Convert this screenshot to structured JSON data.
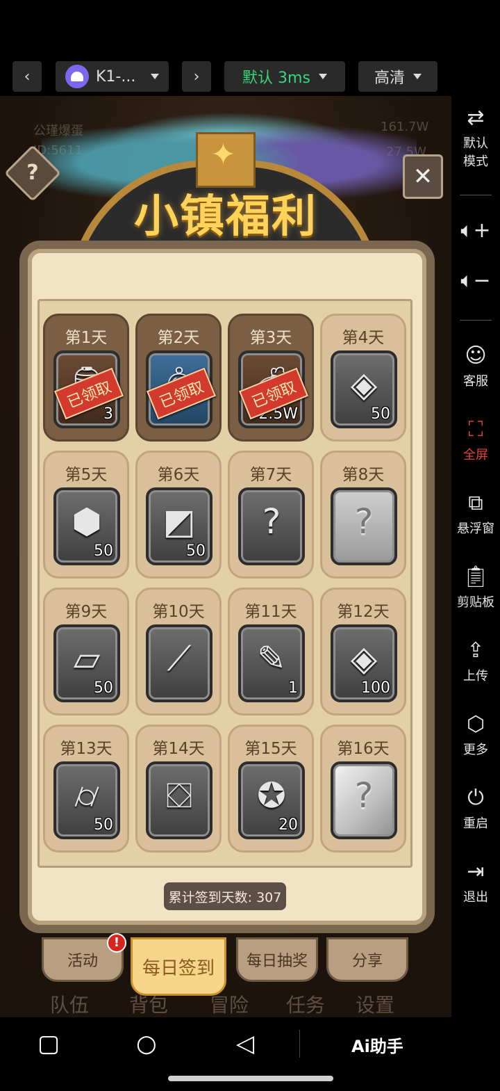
{
  "toolbar": {
    "device_label": "K1-...",
    "latency_label": "默认 3ms",
    "quality_label": "高清",
    "back_icon": "chevron-left-icon",
    "forward_icon": "chevron-right-icon"
  },
  "game": {
    "title": "小镇福利",
    "background_names": [
      "公瑾爆蛋",
      "ID:5611",
      "161.7W",
      "27.5W"
    ],
    "cards": [
      {
        "day": "第1天",
        "claimed": true,
        "stamp": "已领取",
        "qty": "3",
        "item_icon": "lantern-icon"
      },
      {
        "day": "第2天",
        "claimed": true,
        "stamp": "已领取",
        "qty": "",
        "item_icon": "bell-icon"
      },
      {
        "day": "第3天",
        "claimed": true,
        "stamp": "已领取",
        "qty": "2.5W",
        "item_icon": "coin-bag-icon"
      },
      {
        "day": "第4天",
        "claimed": false,
        "stamp": "",
        "qty": "50",
        "item_icon": "rune-stone-icon"
      },
      {
        "day": "第5天",
        "claimed": false,
        "stamp": "",
        "qty": "50",
        "item_icon": "ore-icon"
      },
      {
        "day": "第6天",
        "claimed": false,
        "stamp": "",
        "qty": "50",
        "item_icon": "fragment-icon"
      },
      {
        "day": "第7天",
        "claimed": false,
        "stamp": "",
        "qty": "",
        "item_icon": "question-icon"
      },
      {
        "day": "第8天",
        "claimed": false,
        "stamp": "",
        "qty": "",
        "item_icon": "question-icon"
      },
      {
        "day": "第9天",
        "claimed": false,
        "stamp": "",
        "qty": "50",
        "item_icon": "ingot-icon"
      },
      {
        "day": "第10天",
        "claimed": false,
        "stamp": "",
        "qty": "",
        "item_icon": "feather-icon"
      },
      {
        "day": "第11天",
        "claimed": false,
        "stamp": "",
        "qty": "1",
        "item_icon": "quill-icon"
      },
      {
        "day": "第12天",
        "claimed": false,
        "stamp": "",
        "qty": "100",
        "item_icon": "rune-stone-icon"
      },
      {
        "day": "第13天",
        "claimed": false,
        "stamp": "",
        "qty": "50",
        "item_icon": "log-icon"
      },
      {
        "day": "第14天",
        "claimed": false,
        "stamp": "",
        "qty": "",
        "item_icon": "backpack-icon"
      },
      {
        "day": "第15天",
        "claimed": false,
        "stamp": "",
        "qty": "20",
        "item_icon": "emblem-icon"
      },
      {
        "day": "第16天",
        "claimed": false,
        "stamp": "",
        "qty": "",
        "item_icon": "question-icon"
      }
    ],
    "total_label": "累计签到天数: 307",
    "tabs": [
      {
        "label": "活动",
        "badge": "!"
      },
      {
        "label": "每日签到",
        "active": true
      },
      {
        "label": "每日抽奖"
      },
      {
        "label": "分享"
      }
    ],
    "bottom_tabs": [
      "队伍",
      "背包",
      "冒险",
      "任务",
      "设置"
    ]
  },
  "sidebar": [
    {
      "label": "默认\n模式",
      "icon": "switch-mode-icon"
    },
    {
      "label": "",
      "icon": "volume-up-icon"
    },
    {
      "label": "",
      "icon": "volume-down-icon"
    },
    {
      "label": "客服",
      "icon": "customer-service-icon"
    },
    {
      "label": "全屏",
      "icon": "fullscreen-icon"
    },
    {
      "label": "悬浮窗",
      "icon": "floating-window-icon"
    },
    {
      "label": "剪贴板",
      "icon": "clipboard-icon"
    },
    {
      "label": "上传",
      "icon": "upload-icon"
    },
    {
      "label": "更多",
      "icon": "more-icon"
    },
    {
      "label": "重启",
      "icon": "power-icon"
    },
    {
      "label": "退出",
      "icon": "exit-icon"
    }
  ],
  "sysnav": {
    "ai_label": "Ai助手"
  },
  "colors": {
    "latency": "#37d67a",
    "active_sidebar": "#e5413a",
    "title": "#ffd25a"
  }
}
